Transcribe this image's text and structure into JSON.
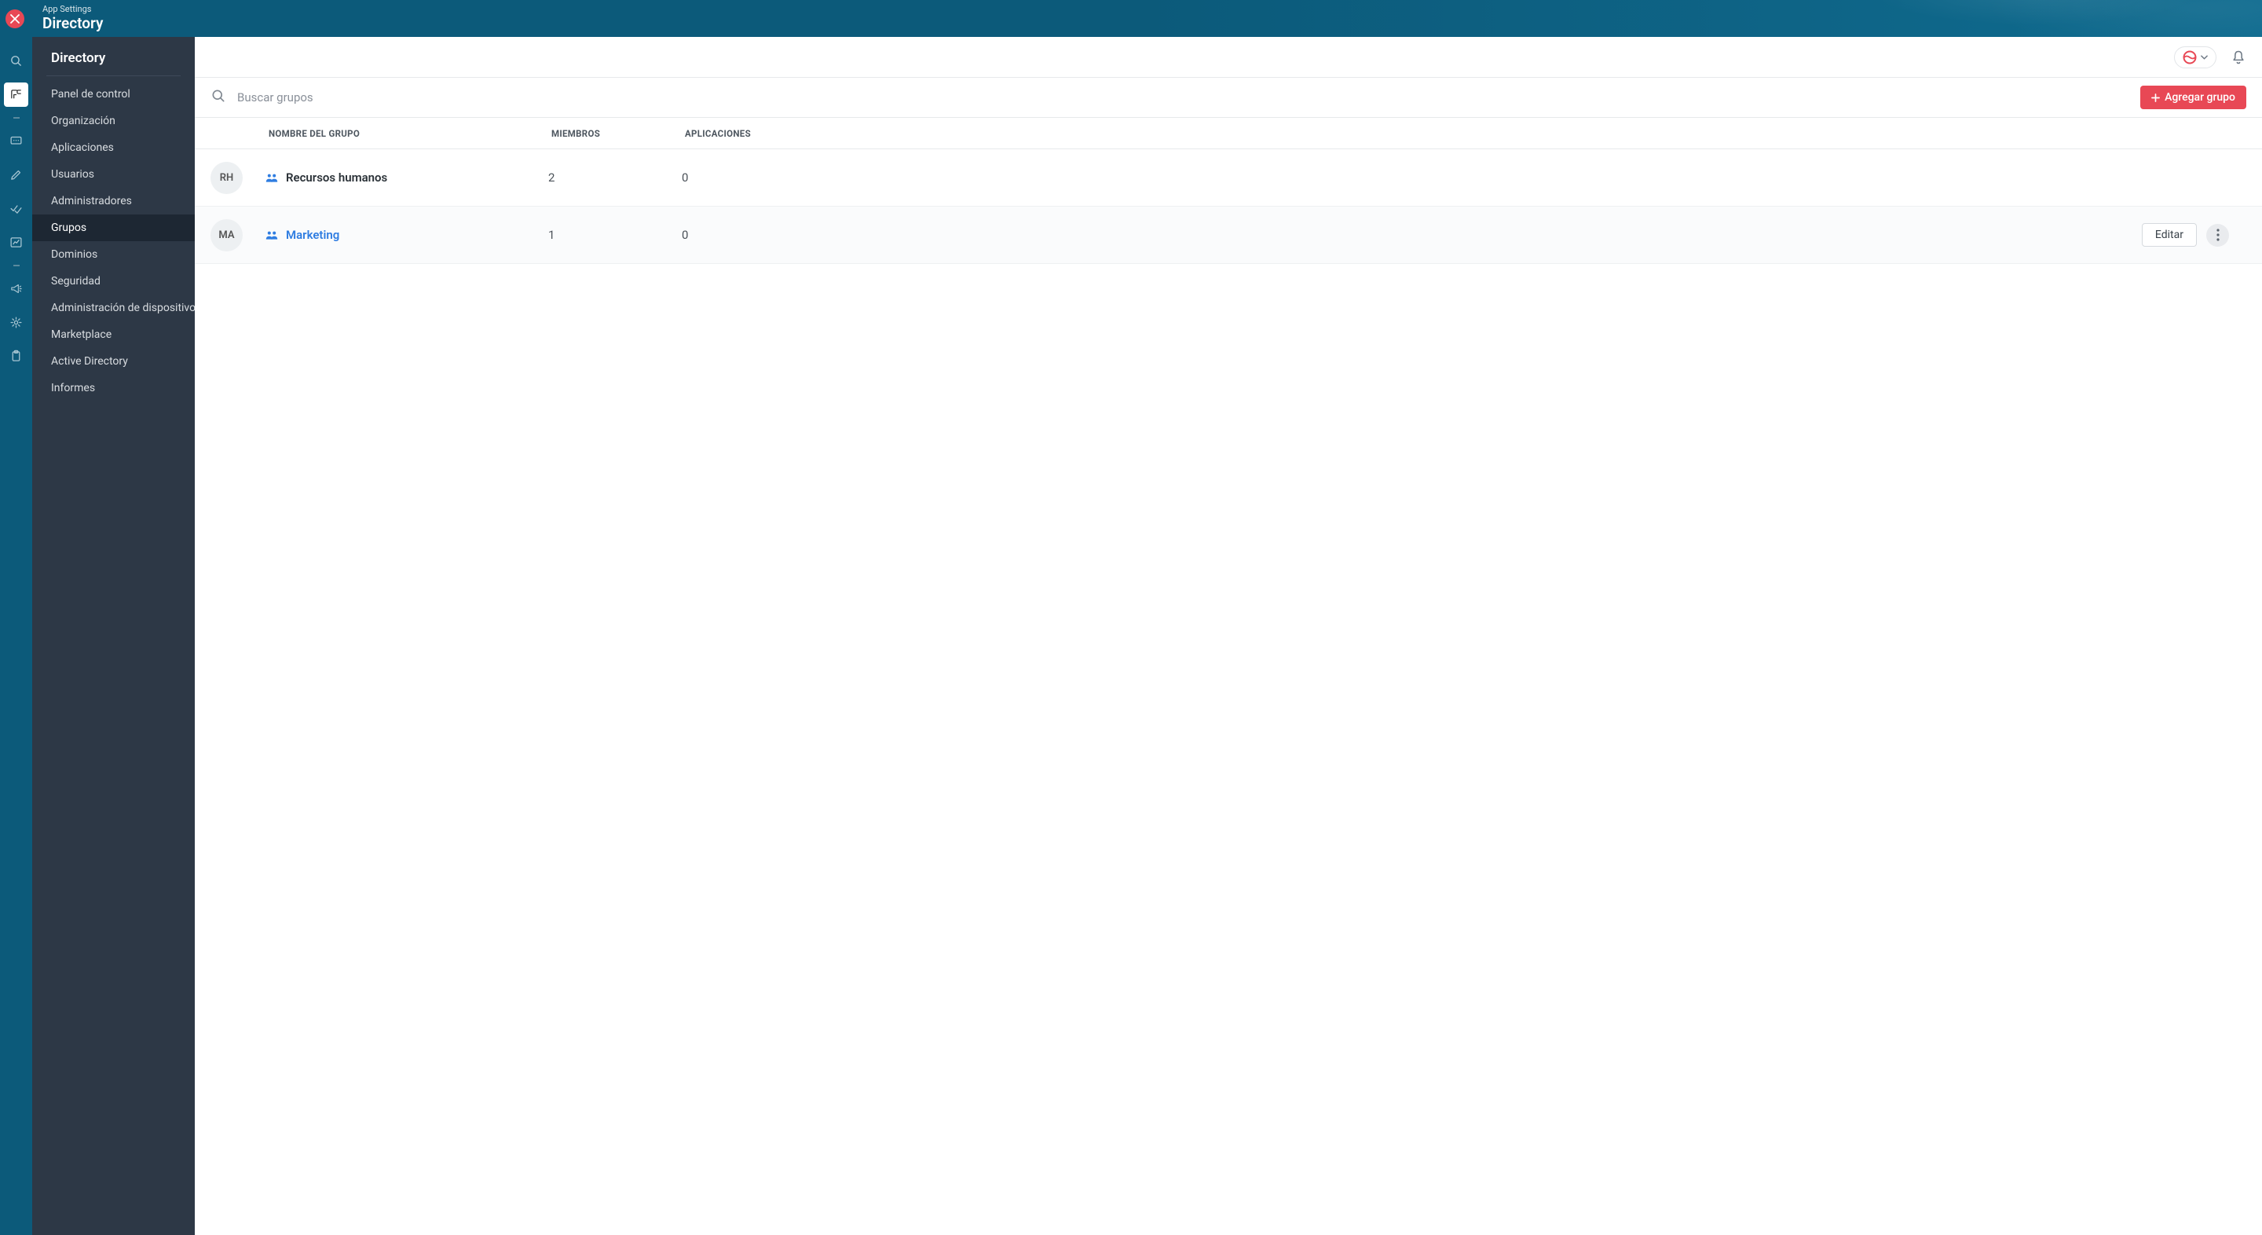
{
  "header": {
    "subtitle": "App Settings",
    "title": "Directory"
  },
  "sidebar": {
    "title": "Directory",
    "items": [
      {
        "label": "Panel de control",
        "active": false
      },
      {
        "label": "Organización",
        "active": false
      },
      {
        "label": "Aplicaciones",
        "active": false
      },
      {
        "label": "Usuarios",
        "active": false
      },
      {
        "label": "Administradores",
        "active": false
      },
      {
        "label": "Grupos",
        "active": true
      },
      {
        "label": "Dominios",
        "active": false
      },
      {
        "label": "Seguridad",
        "active": false
      },
      {
        "label": "Administración de dispositivos",
        "active": false
      },
      {
        "label": "Marketplace",
        "active": false
      },
      {
        "label": "Active Directory",
        "active": false
      },
      {
        "label": "Informes",
        "active": false
      }
    ]
  },
  "search": {
    "placeholder": "Buscar grupos"
  },
  "buttons": {
    "add_group": "Agregar grupo",
    "edit": "Editar"
  },
  "table": {
    "columns": {
      "name": "NOMBRE DEL GRUPO",
      "members": "MIEMBROS",
      "apps": "APLICACIONES"
    },
    "rows": [
      {
        "avatar": "RH",
        "name": "Recursos humanos",
        "members": "2",
        "apps": "0",
        "hovered": false
      },
      {
        "avatar": "MA",
        "name": "Marketing",
        "members": "1",
        "apps": "0",
        "hovered": true
      }
    ]
  },
  "colors": {
    "accent_red": "#e84855",
    "link_blue": "#2f7de1"
  }
}
